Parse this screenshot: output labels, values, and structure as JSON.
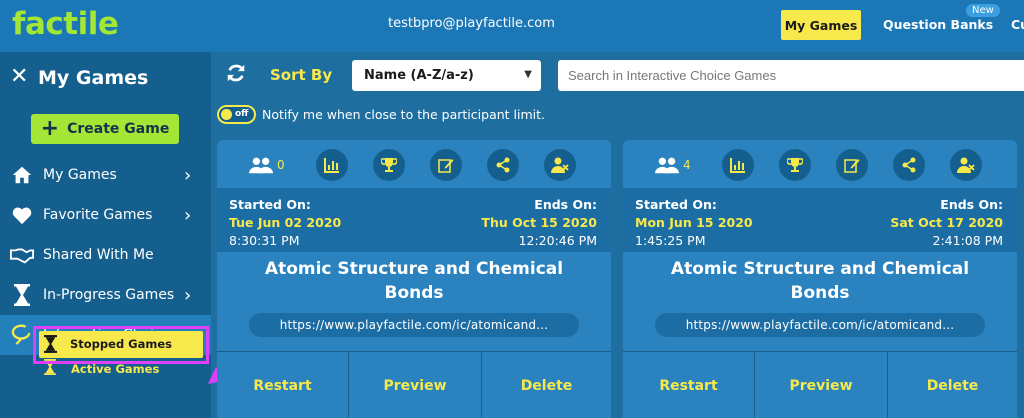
{
  "app": {
    "logo": "factile",
    "email": "testbpro@playfactile.com"
  },
  "topnav": {
    "my_games": "My Games",
    "question_banks": "Question Banks",
    "new_badge": "New",
    "cut_item": "Cu"
  },
  "sidebar": {
    "title": "My Games",
    "create_button": "Create Game",
    "items": [
      {
        "label": "My Games",
        "icon": "home-icon"
      },
      {
        "label": "Favorite Games",
        "icon": "heart-icon"
      },
      {
        "label": "Shared With Me",
        "icon": "handshake-icon"
      },
      {
        "label": "In-Progress Games",
        "icon": "hourglass-icon"
      },
      {
        "label": "Interactive Choice",
        "icon": "interactive-choice-icon"
      }
    ],
    "subitems": [
      {
        "label": "Active Games",
        "icon": "hourglass-icon"
      },
      {
        "label": "Stopped Games",
        "icon": "hourglass-icon"
      }
    ]
  },
  "toolbar": {
    "sort_label": "Sort By",
    "sort_value": "Name (A-Z/a-z)",
    "search_placeholder": "Search in Interactive Choice Games",
    "toggle_text": "off",
    "notify_text": "Notify me when close to the participant limit."
  },
  "cards": [
    {
      "participants": "0",
      "started_label": "Started On:",
      "ends_label": "Ends On:",
      "start_date": "Tue Jun 02 2020",
      "start_time": "8:30:31 PM",
      "end_date": "Thu Oct 15 2020",
      "end_time": "12:20:46 PM",
      "title": "Atomic Structure and Chemical Bonds",
      "url": "https://www.playfactile.com/ic/atomicand...",
      "actions": [
        "Restart",
        "Preview",
        "Delete"
      ]
    },
    {
      "participants": "4",
      "started_label": "Started On:",
      "ends_label": "Ends On:",
      "start_date": "Mon Jun 15 2020",
      "start_time": "1:45:25 PM",
      "end_date": "Sat Oct 17 2020",
      "end_time": "2:41:08 PM",
      "title": "Atomic Structure and Chemical Bonds",
      "url": "https://www.playfactile.com/ic/atomicand...",
      "actions": [
        "Restart",
        "Preview",
        "Delete"
      ]
    }
  ],
  "colors": {
    "accent_yellow": "#f7e94b",
    "brand_green": "#a3e635",
    "highlight_magenta": "#e040fb",
    "topbar_blue": "#1b77b5"
  }
}
